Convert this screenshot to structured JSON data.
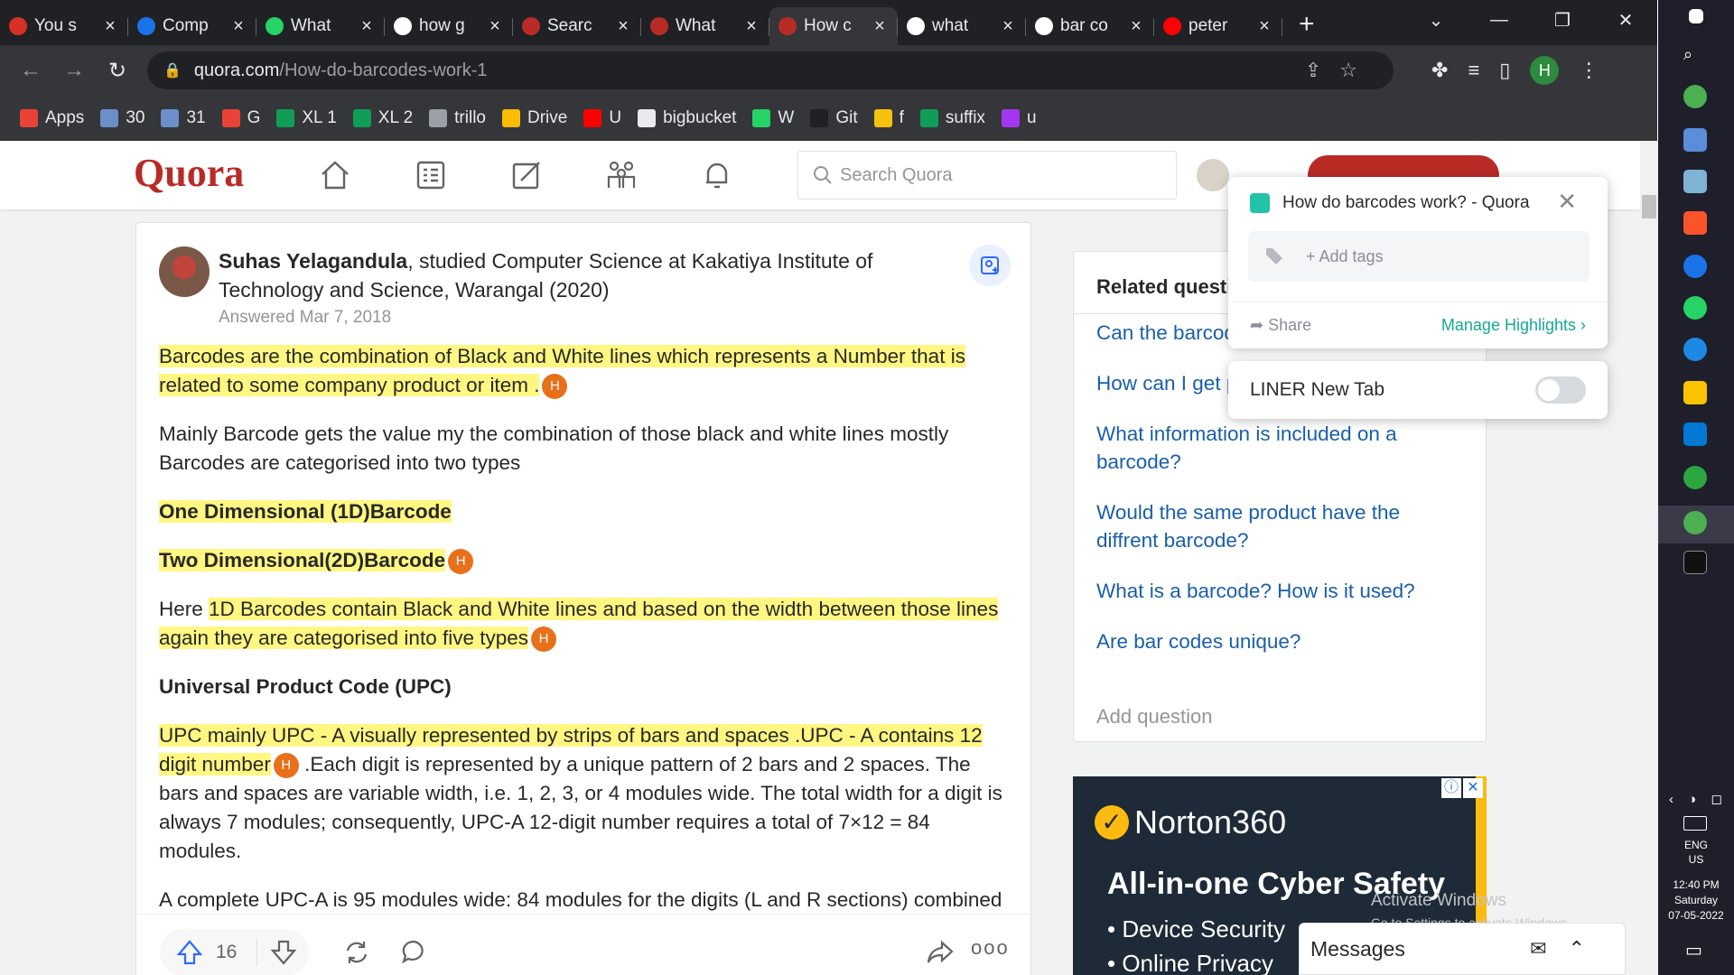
{
  "browser": {
    "tabs": [
      {
        "label": "You s",
        "favicon": "fire-icon",
        "color": "#d93025",
        "active": false
      },
      {
        "label": "Comp",
        "favicon": "c-icon",
        "color": "#1a73e8",
        "active": false
      },
      {
        "label": "What",
        "favicon": "whatsapp-icon",
        "color": "#25d366",
        "active": false
      },
      {
        "label": "how g",
        "favicon": "google-icon",
        "color": "#ffffff",
        "active": false
      },
      {
        "label": "Searc",
        "favicon": "quora-icon",
        "color": "#b92b27",
        "active": false
      },
      {
        "label": "What",
        "favicon": "quora-icon",
        "color": "#b92b27",
        "active": false
      },
      {
        "label": "How c",
        "favicon": "quora-icon",
        "color": "#b92b27",
        "active": true
      },
      {
        "label": "what",
        "favicon": "google-icon",
        "color": "#ffffff",
        "active": false
      },
      {
        "label": "bar co",
        "favicon": "google-icon",
        "color": "#ffffff",
        "active": false
      },
      {
        "label": "peter",
        "favicon": "youtube-icon",
        "color": "#ff0000",
        "active": false
      }
    ],
    "new_tab": "+",
    "url_host": "quora.com",
    "url_path": "/How-do-barcodes-work-1",
    "profile_initial": "H",
    "bookmarks": [
      {
        "label": "Apps",
        "icon": "apps-grid-icon",
        "color": "#ea4335"
      },
      {
        "label": "30",
        "icon": "site-icon",
        "color": "#6d8fc9"
      },
      {
        "label": "31",
        "icon": "site-icon",
        "color": "#6d8fc9"
      },
      {
        "label": "G",
        "icon": "gmail-icon",
        "color": "#ea4335"
      },
      {
        "label": "XL 1",
        "icon": "plus-green-icon",
        "color": "#0f9d58"
      },
      {
        "label": "XL 2",
        "icon": "plus-green-icon",
        "color": "#0f9d58"
      },
      {
        "label": "trillo",
        "icon": "image-icon",
        "color": "#9aa0a6"
      },
      {
        "label": "Drive",
        "icon": "drive-icon",
        "color": "#fbbc04"
      },
      {
        "label": "U",
        "icon": "youtube-icon",
        "color": "#ff0000"
      },
      {
        "label": "bigbucket",
        "icon": "globe-icon",
        "color": "#e8eaed"
      },
      {
        "label": "W",
        "icon": "whatsapp-icon",
        "color": "#25d366"
      },
      {
        "label": "Git",
        "icon": "github-icon",
        "color": "#202124"
      },
      {
        "label": "f",
        "icon": "file-icon",
        "color": "#f4c20d"
      },
      {
        "label": "suffix",
        "icon": "plus-green-icon",
        "color": "#0f9d58"
      },
      {
        "label": "u",
        "icon": "udemy-icon",
        "color": "#a435f0"
      }
    ]
  },
  "quora": {
    "logo": "Quora",
    "search_placeholder": "Search Quora",
    "answer": {
      "author_name": "Suhas Yelagandula",
      "author_credential": ", studied Computer Science at Kakatiya Institute of Technology and Science, Warangal (2020)",
      "answered": "Answered Mar 7, 2018",
      "p1": "Barcodes are the combination of Black and White lines which represents a Number that is related to some company product or item .",
      "p2": "Mainly Barcode gets the value my the combination of those black and white lines mostly Barcodes are categorised into two types",
      "h1": "One Dimensional (1D)Barcode",
      "h2": "Two Dimensional(2D)Barcode",
      "p3_prefix": "Here ",
      "p3_hl": "1D Barcodes contain Black and White lines and based on the width between those lines again they are categorised into five types",
      "h3": "Universal Product Code (UPC)",
      "p4_hl": "UPC mainly UPC - A visually represented by strips of bars and spaces .UPC - A contains 12 digit number",
      "p4_rest": " .Each digit is represented by a unique pattern of 2 bars and 2 spaces. The bars and spaces are variable width, i.e. 1, 2, 3, or 4 modules wide. The total width for a digit is always 7 modules; consequently, UPC-A 12-digit number requires a total of 7×12 = 84 modules.",
      "p5": "A complete UPC-A is 95 modules wide: 84 modules for the digits (L and R sections) combined",
      "highlight_badge": "H",
      "upvotes": "16"
    },
    "related": {
      "title": "Related questi",
      "items": [
        "Can the barcod",
        "How can I get product that I j",
        "What information is included on a barcode?",
        "Would the same product have the diffrent barcode?",
        "What is a barcode? How is it used?",
        "Are bar codes unique?"
      ],
      "add_question": "Add question"
    },
    "ad": {
      "brand": "Norton360",
      "headline": "All-in-one Cyber Safety",
      "bullet1": "• Device Security",
      "bullet2": "• Online Privacy"
    },
    "messages_label": "Messages"
  },
  "liner": {
    "title": "How do barcodes work? - Quora",
    "add_tags": "+ Add tags",
    "share": "Share",
    "manage": "Manage Highlights ›",
    "newtab_label": "LINER New Tab"
  },
  "watermark": {
    "line1": "Activate Windows",
    "line2": "Go to Settings to activate Windows."
  },
  "taskbar": {
    "lang1": "ENG",
    "lang2": "US",
    "time": "12:40 PM",
    "day": "Saturday",
    "date": "07-05-2022"
  }
}
